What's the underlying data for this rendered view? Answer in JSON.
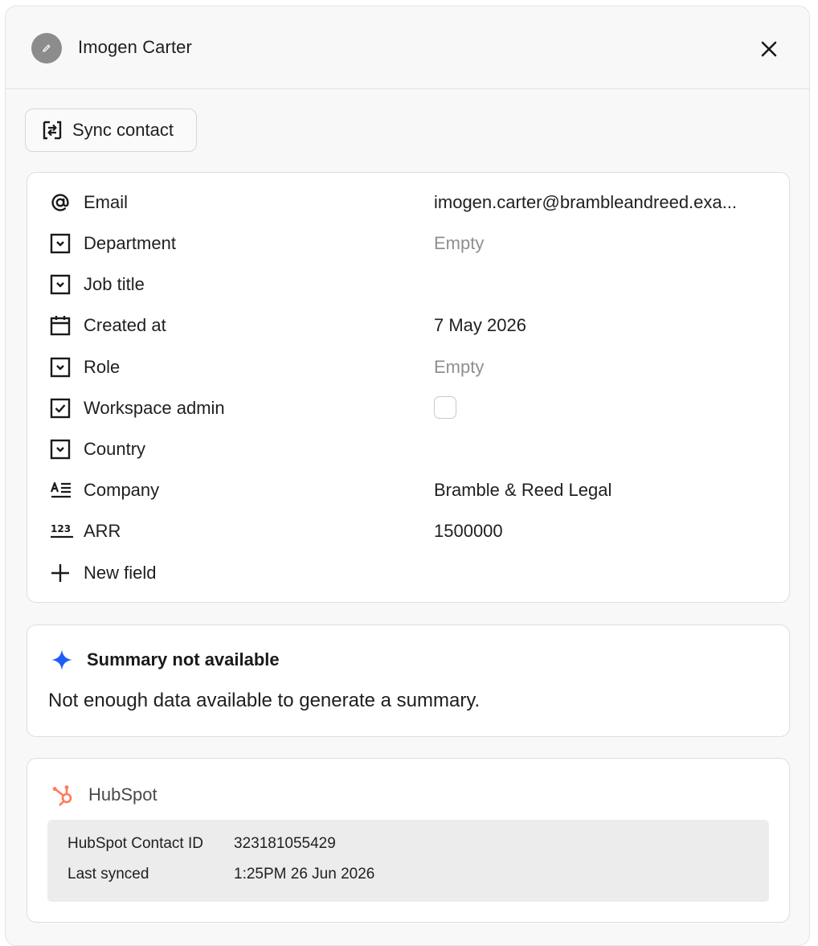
{
  "header": {
    "title": "Imogen Carter"
  },
  "toolbar": {
    "sync_label": "Sync contact"
  },
  "fields": [
    {
      "icon": "at-icon",
      "label": "Email",
      "value": "imogen.carter@brambleandreed.exa...",
      "empty": false
    },
    {
      "icon": "select-icon",
      "label": "Department",
      "value": "Empty",
      "empty": true
    },
    {
      "icon": "select-icon",
      "label": "Job title",
      "value": "",
      "empty": false
    },
    {
      "icon": "calendar-icon",
      "label": "Created at",
      "value": "7 May 2026",
      "empty": false
    },
    {
      "icon": "select-icon",
      "label": "Role",
      "value": "Empty",
      "empty": true
    },
    {
      "icon": "checkbox-icon",
      "label": "Workspace admin",
      "value": "",
      "checkbox": true,
      "checked": false
    },
    {
      "icon": "select-icon",
      "label": "Country",
      "value": "",
      "empty": false
    },
    {
      "icon": "text-icon",
      "label": "Company",
      "value": "Bramble & Reed Legal",
      "empty": false
    },
    {
      "icon": "number-icon",
      "label": "ARR",
      "value": "1500000",
      "empty": false
    }
  ],
  "new_field_label": "New field",
  "summary": {
    "title": "Summary not available",
    "body": "Not enough data available to generate a summary."
  },
  "hubspot": {
    "title": "HubSpot",
    "rows": [
      {
        "label": "HubSpot Contact ID",
        "value": "323181055429"
      },
      {
        "label": "Last synced",
        "value": "1:25PM 26 Jun 2026"
      }
    ]
  },
  "colors": {
    "accent_blue": "#1f5cf5",
    "hubspot_orange": "#ff7a59",
    "muted_text": "#8f8f8f"
  }
}
